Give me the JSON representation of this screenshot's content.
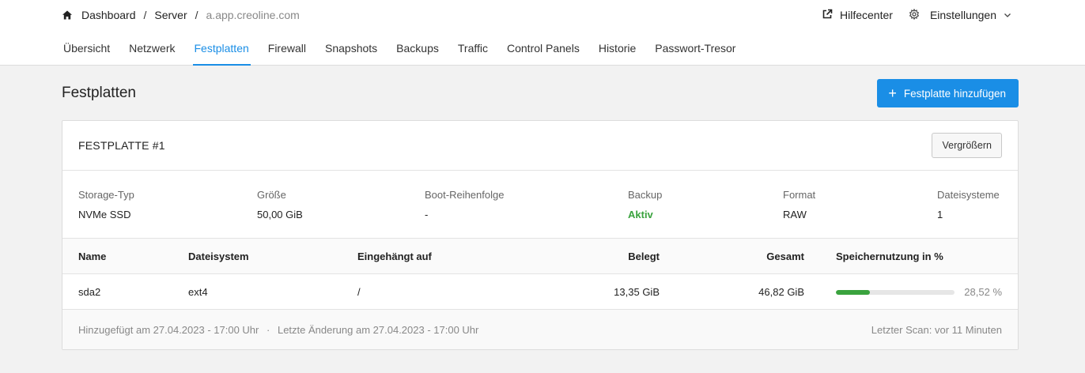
{
  "breadcrumb": {
    "home_icon": "home-icon",
    "items": [
      "Dashboard",
      "Server"
    ],
    "current": "a.app.creoline.com"
  },
  "header_right": {
    "help_label": "Hilfecenter",
    "help_icon": "external-link-icon",
    "settings_label": "Einstellungen",
    "settings_icon": "gear-icon"
  },
  "tabs": [
    {
      "label": "Übersicht"
    },
    {
      "label": "Netzwerk"
    },
    {
      "label": "Festplatten",
      "active": true
    },
    {
      "label": "Firewall"
    },
    {
      "label": "Snapshots"
    },
    {
      "label": "Backups"
    },
    {
      "label": "Traffic"
    },
    {
      "label": "Control Panels"
    },
    {
      "label": "Historie"
    },
    {
      "label": "Passwort-Tresor"
    }
  ],
  "page": {
    "title": "Festplatten",
    "add_button": "Festplatte hinzufügen"
  },
  "disk": {
    "title": "FESTPLATTE #1",
    "enlarge_button": "Vergrößern",
    "info": {
      "storage_type_label": "Storage-Typ",
      "storage_type": "NVMe SSD",
      "size_label": "Größe",
      "size": "50,00 GiB",
      "boot_label": "Boot-Reihenfolge",
      "boot": "-",
      "backup_label": "Backup",
      "backup": "Aktiv",
      "format_label": "Format",
      "format": "RAW",
      "fs_label": "Dateisysteme",
      "fs_count": "1"
    },
    "table": {
      "headers": {
        "name": "Name",
        "filesystem": "Dateisystem",
        "mount": "Eingehängt auf",
        "used": "Belegt",
        "total": "Gesamt",
        "usage": "Speichernutzung in %"
      },
      "rows": [
        {
          "name": "sda2",
          "filesystem": "ext4",
          "mount": "/",
          "used": "13,35 GiB",
          "total": "46,82 GiB",
          "usage_pct": "28,52 %",
          "usage_fraction": 0.2852
        }
      ]
    },
    "footer": {
      "added": "Hinzugefügt am 27.04.2023 - 17:00 Uhr",
      "separator": "·",
      "changed": "Letzte Änderung am 27.04.2023 - 17:00 Uhr",
      "last_scan": "Letzter Scan: vor 11 Minuten"
    }
  },
  "colors": {
    "accent": "#1a8ee6",
    "success": "#3aa33e"
  }
}
